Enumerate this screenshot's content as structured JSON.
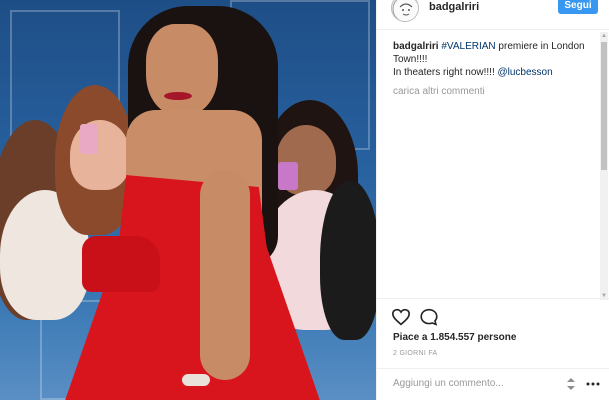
{
  "post": {
    "username": "badgalriri",
    "follow_label": "Segui",
    "caption": {
      "author": "badgalriri",
      "hashtag": "#VALERIAN",
      "text_after_hashtag": " premiere in London Town!!!!",
      "line2": "In theaters right now!!!! ",
      "mention": "@lucbesson"
    },
    "load_more_label": "carica altri commenti",
    "likes_label": "Piace a 1.854.557 persone",
    "timestamp": "2 GIORNI FA",
    "comment_placeholder": "Aggiungi un commento..."
  },
  "icons": {
    "like": "heart-icon",
    "comment": "comment-icon",
    "options": "updown-icon",
    "more": "dots-icon"
  },
  "colors": {
    "follow_button": "#3897f0",
    "link": "#003569",
    "dress": "#d8151c"
  }
}
